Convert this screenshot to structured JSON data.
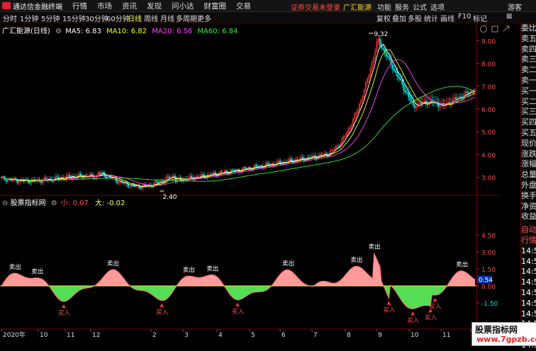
{
  "app": {
    "name": "通达信金融终端"
  },
  "menu": [
    "行情",
    "市场",
    "资讯",
    "发现",
    "问小达",
    "财富圈",
    "交易"
  ],
  "alert": {
    "text": "证券交易未登录",
    "stock": "广汇能源"
  },
  "right_menu": [
    "功能",
    "服务",
    "公式",
    "选项",
    "游客"
  ],
  "toolbar": {
    "periods": [
      "分时",
      "1分钟",
      "5分钟",
      "15分钟",
      "30分钟",
      "60分钟",
      "日线",
      "周线",
      "月线",
      "多周期",
      "更多"
    ],
    "active": "日线",
    "right": [
      "复权",
      "叠加",
      "多股",
      "统计",
      "画线",
      "F10",
      "标记",
      "⊠"
    ]
  },
  "main_legend": {
    "title": "广汇能源(日线)",
    "ma5": "MA5: 6.83",
    "ma10": "MA10: 6.82",
    "ma20": "MA20: 6.56",
    "ma60": "MA60: 6.84",
    "ma5_color": "#ffffff",
    "ma10_color": "#ffff00",
    "ma20_color": "#ff44ff",
    "ma60_color": "#33ee33"
  },
  "price_axis": [
    "9.00",
    "8.00",
    "7.00",
    "6.00",
    "5.00",
    "4.00",
    "3.00"
  ],
  "price_labels": {
    "high": "9.32",
    "low": "2.40"
  },
  "indicator": {
    "name": "股票指标网",
    "small_label": "小: 0.07",
    "big_label": "大: -0.02",
    "axis": [
      "4.50",
      "3.00",
      "1.50",
      "0.00",
      "-1.50"
    ],
    "current_tag": "0.54",
    "sell_label": "卖出",
    "buy_label": "买入"
  },
  "date_axis": [
    "2020年",
    "10",
    "11",
    "12",
    "2",
    "3",
    "4",
    "5",
    "6",
    "7",
    "8",
    "9",
    "10",
    "11",
    "12"
  ],
  "side_panel": {
    "items": [
      "委比",
      "卖五",
      "卖四",
      "卖三",
      "卖二",
      "卖一",
      "买一",
      "买二",
      "买三",
      "买四",
      "买五",
      "现价",
      "涨跌",
      "涨幅",
      "总量",
      "外盘",
      "换手",
      "净资",
      "收益"
    ],
    "tail_labels": [
      "自动",
      "行情"
    ],
    "times": [
      "14:50",
      "14:50",
      "14:50",
      "14:50",
      "14:50",
      "14:50",
      "14:50",
      "14:50",
      "14:50",
      "14:50"
    ]
  },
  "watermark": {
    "line1": "股票指标网",
    "line2": "www.7gpzb.com"
  },
  "colors": {
    "up": "#ff3333",
    "down": "#00dddd",
    "pos_fill": "#ff9a9a",
    "neg_fill": "#55dd55",
    "zero_line": "#ffee00"
  }
}
